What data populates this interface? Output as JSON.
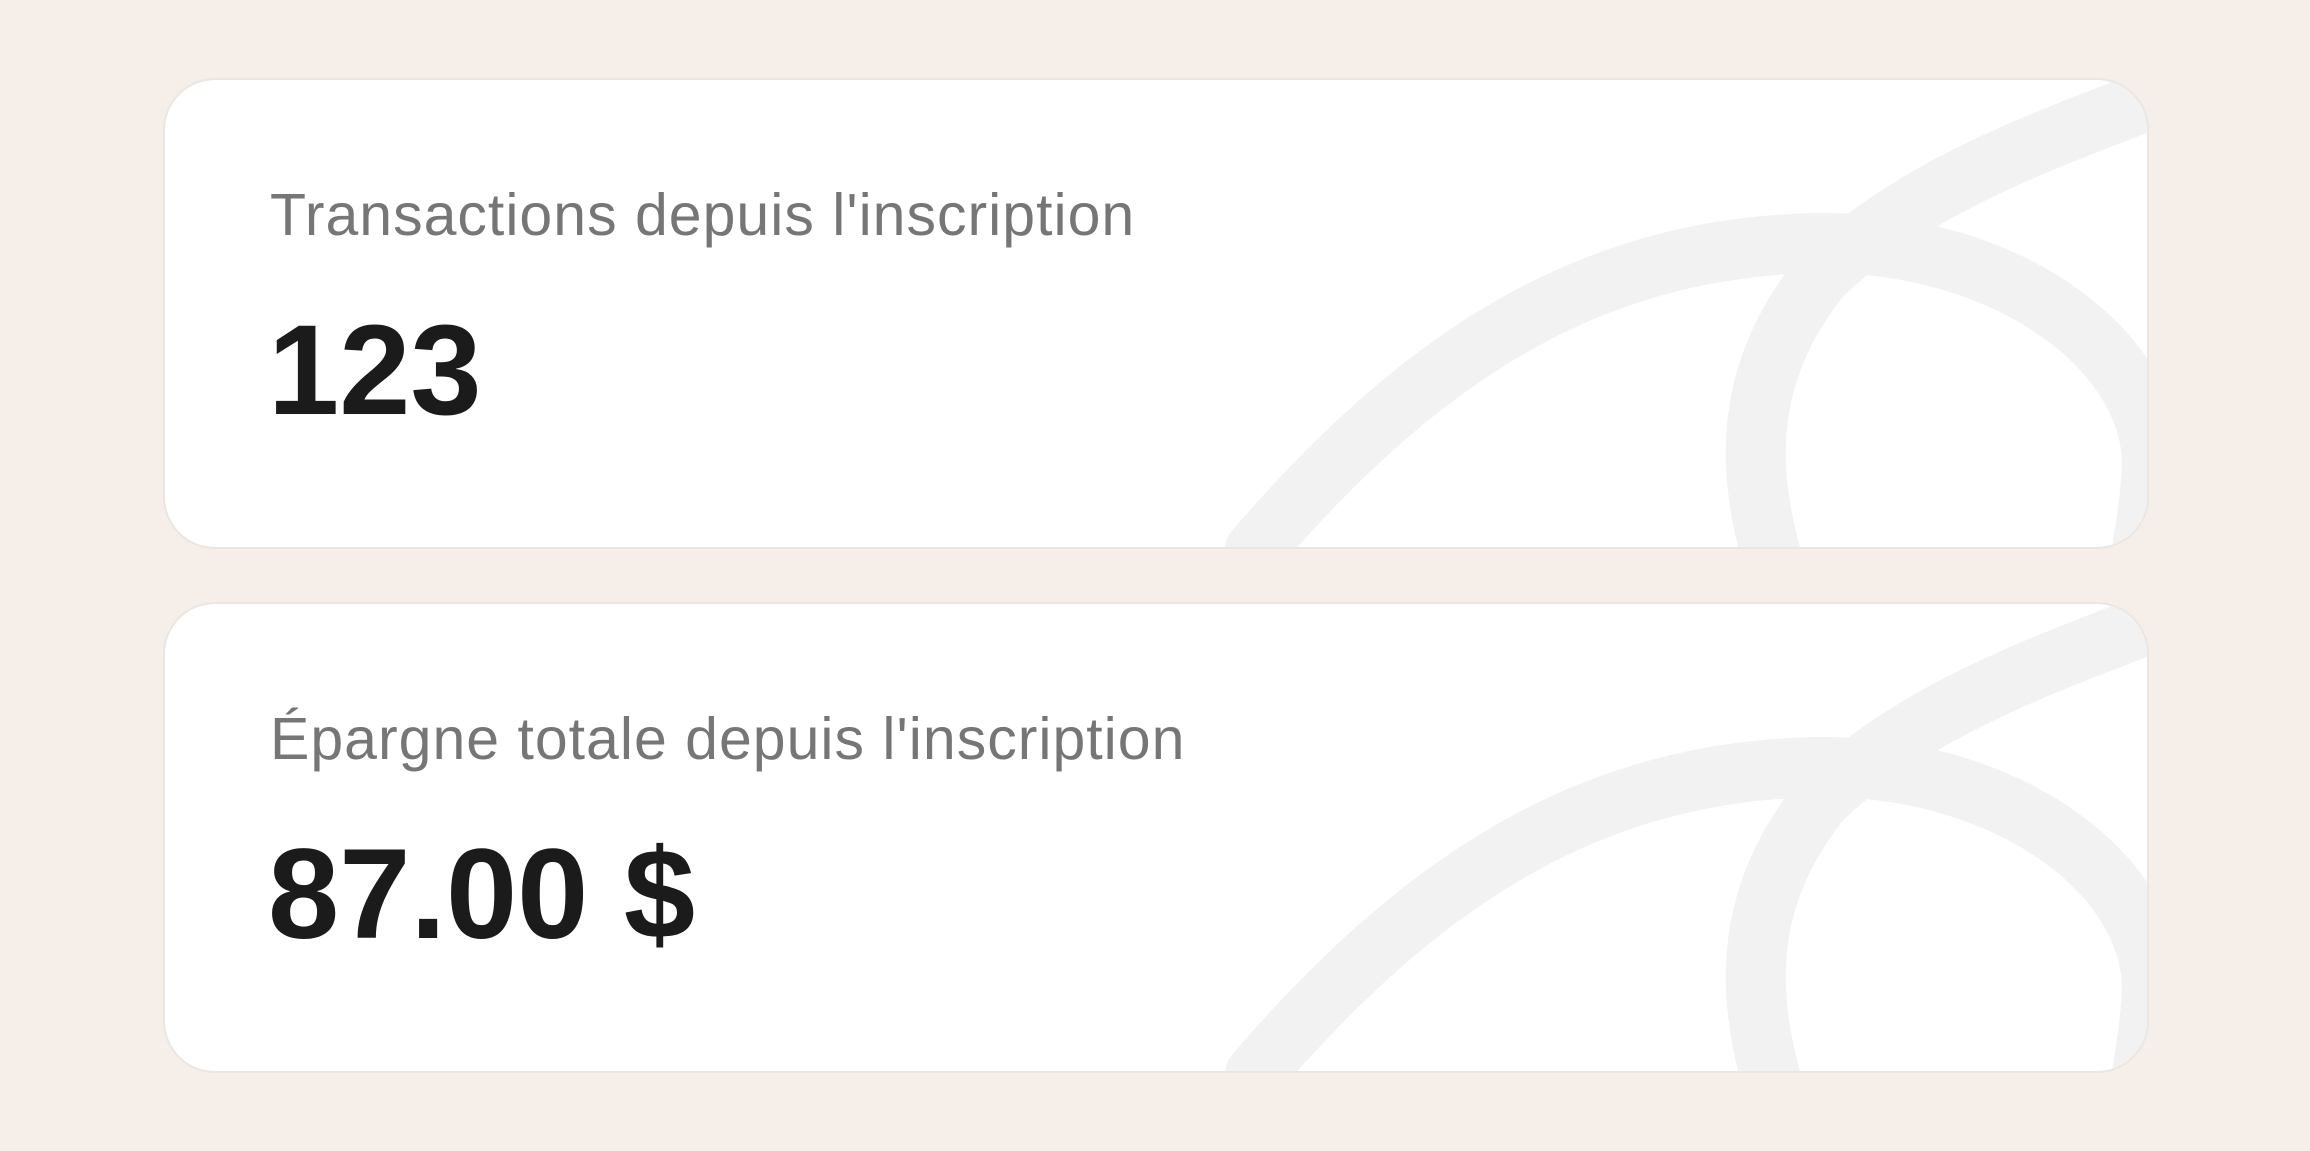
{
  "theme": {
    "background": "#f5eee9",
    "card_background": "#ffffff",
    "label_color": "#767676",
    "value_color": "#1b1b1b",
    "decoration_color": "#f2f2f2"
  },
  "stats": [
    {
      "label": "Transactions depuis l'inscription",
      "value": "123"
    },
    {
      "label": "Épargne totale depuis l'inscription",
      "value": "87.00 $"
    }
  ]
}
